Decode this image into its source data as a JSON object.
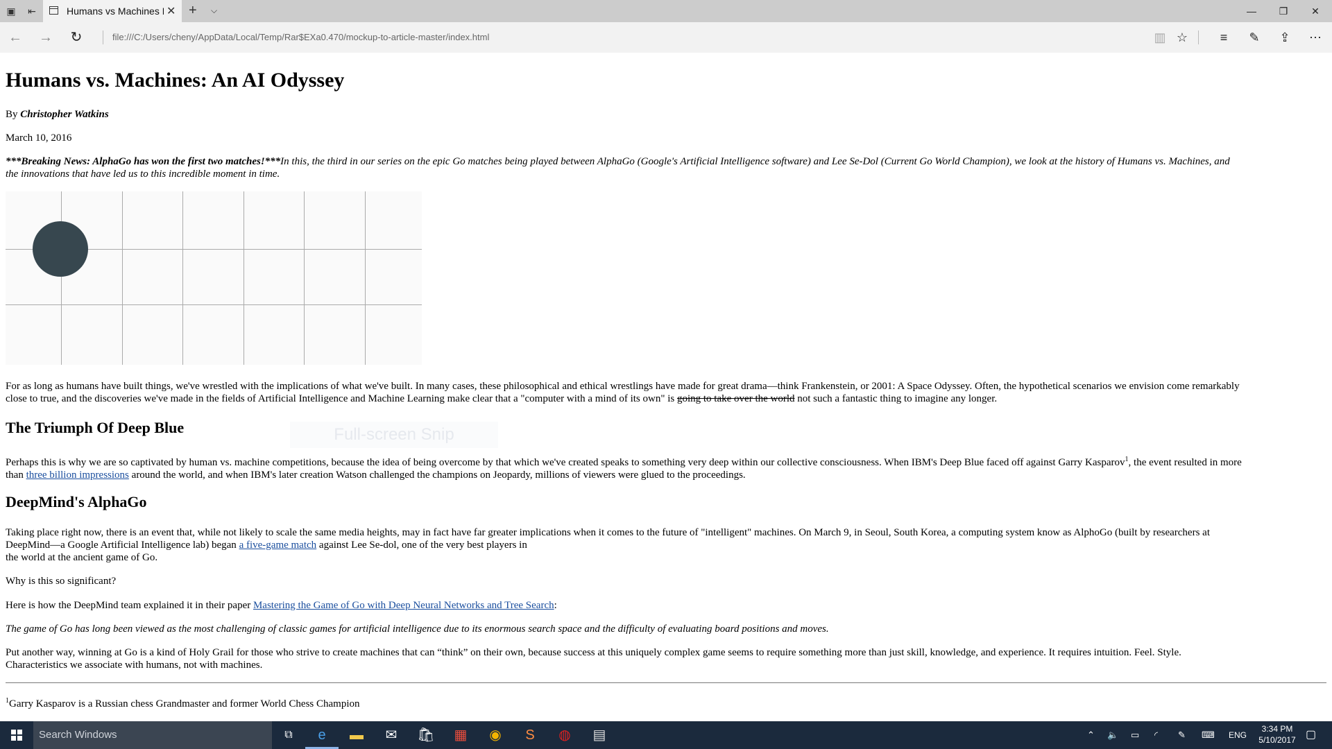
{
  "browser": {
    "tab_title": "Humans vs Machines Bl",
    "url": "file:///C:/Users/cheny/AppData/Local/Temp/Rar$EXa0.470/mockup-to-article-master/index.html"
  },
  "article": {
    "title": "Humans vs. Machines: An AI Odyssey",
    "by_prefix": "By",
    "author": "Christopher Watkins",
    "date": "March 10, 2016",
    "intro_bold": "***Breaking News: AlphaGo has won the first two matches!***",
    "intro_italic_1": "In this, the third in our series on the epic Go matches being played between AlphaGo (Google's Artificial Intelligence software) and Lee Se-Dol (Current Go World Champion), we look at the history of Humans vs. Machines, and",
    "intro_italic_2": "the innovations that have led us to this incredible moment in time.",
    "p1_line1": "For as long as humans have built things, we've wrestled with the implications of what we've built. In many cases, these philosophical and ethical wrestlings have made for great drama—think Frankenstein, or 2001: A Space Odyssey. Often, the hypothetical scenarios we envision come remarkably",
    "p1_line2_a": "close to true, and the discoveries we've made in the fields of Artificial Intelligence and Machine Learning make clear that a \"computer with a mind of its own\" is",
    "p1_strike": "going to take over the world",
    "p1_line2_b": "not such a fantastic thing to imagine any longer.",
    "h2_deep_blue": "The Triumph Of Deep Blue",
    "p2_line1": "Perhaps this is why we are so captivated by human vs. machine competitions, because the idea of being overcome by that which we've created speaks to something very deep within our collective consciousness. When IBM's Deep Blue faced off against Garry Kasparov",
    "p2_sup": "1",
    "p2_line1_end": ", the event resulted in more",
    "p2_line2_a": "than",
    "p2_link": "three billion impressions",
    "p2_line2_b": "around the world, and when IBM's later creation Watson challenged the champions on Jeopardy, millions of viewers were glued to the proceedings.",
    "h2_alphago": "DeepMind's AlphaGo",
    "p3_line1": "Taking place right now, there is an event that, while not likely to scale the same media heights, may in fact have far greater implications when it comes to the future of \"intelligent\" machines. On March 9, in Seoul, South Korea, a computing system know as AlphoGo (built by researchers at",
    "p3_line2_a": "DeepMind—a Google Artificial Intelligence lab) began",
    "p3_link": "a five-game match",
    "p3_line2_b": "against Lee Se-dol, one of the very best players in",
    "p3_line3": "the world at the ancient game of Go.",
    "p4": "Why is this so significant?",
    "p5_a": "Here is how the DeepMind team explained it in their paper",
    "p5_link": "Mastering the Game of Go with Deep Neural Networks and Tree Search",
    "p5_b": ":",
    "quote": "The game of Go has long been viewed as the most challenging of classic games for artificial intelligence due to its enormous search space and the difficulty of evaluating board positions and moves.",
    "p6_line1": "Put another way, winning at Go is a kind of Holy Grail for those who strive to create machines that can “think” on their own, because success at this uniquely complex game seems to require something more than just skill, knowledge, and experience. It requires intuition. Feel. Style.",
    "p6_line2": "Characteristics we associate with humans, not with machines.",
    "footnote_sup": "1",
    "footnote": "Garry Kasparov is a Russian chess Grandmaster and former World Chess Champion"
  },
  "overlay": {
    "snip_label": "Full-screen Snip"
  },
  "taskbar": {
    "search_placeholder": "Search Windows",
    "language": "ENG",
    "time": "3:34 PM",
    "date": "5/10/2017"
  },
  "colors": {
    "stone": "#37474f",
    "link": "#1a4e9e",
    "taskbar": "#1b2a3d"
  }
}
